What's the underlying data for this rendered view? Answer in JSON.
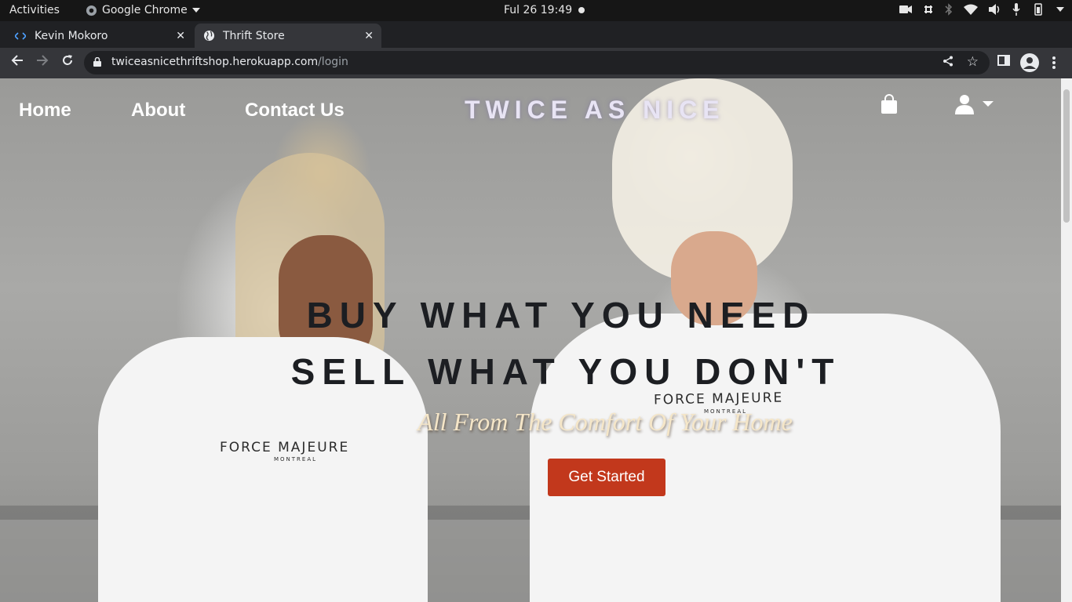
{
  "os_bar": {
    "activities": "Activities",
    "app_name": "Google Chrome",
    "clock": "Ful 26  19:49"
  },
  "browser": {
    "tabs": [
      {
        "title": "Kevin Mokoro",
        "icon": "code-icon",
        "active": false
      },
      {
        "title": "Thrift Store",
        "icon": "globe-icon",
        "active": true
      }
    ],
    "url_host": "twiceasnicethriftshop.herokuapp.com",
    "url_path": "/login"
  },
  "site": {
    "nav": {
      "home": "Home",
      "about": "About",
      "contact": "Contact Us"
    },
    "logo": "TWICE AS NICE",
    "hero": {
      "line1": "BUY WHAT YOU NEED",
      "line2": "SELL WHAT YOU DON'T",
      "subtitle": "All From The Comfort Of Your Home",
      "cta_label": "Get Started"
    },
    "shirt_print": {
      "brand": "FORCE MAJEURE",
      "city": "MONTREAL"
    }
  },
  "colors": {
    "cta_background": "#c2381c",
    "logo_text": "#e8e4f4",
    "hero_text": "#1c1e22",
    "subtitle_text": "#f5e6c8"
  }
}
